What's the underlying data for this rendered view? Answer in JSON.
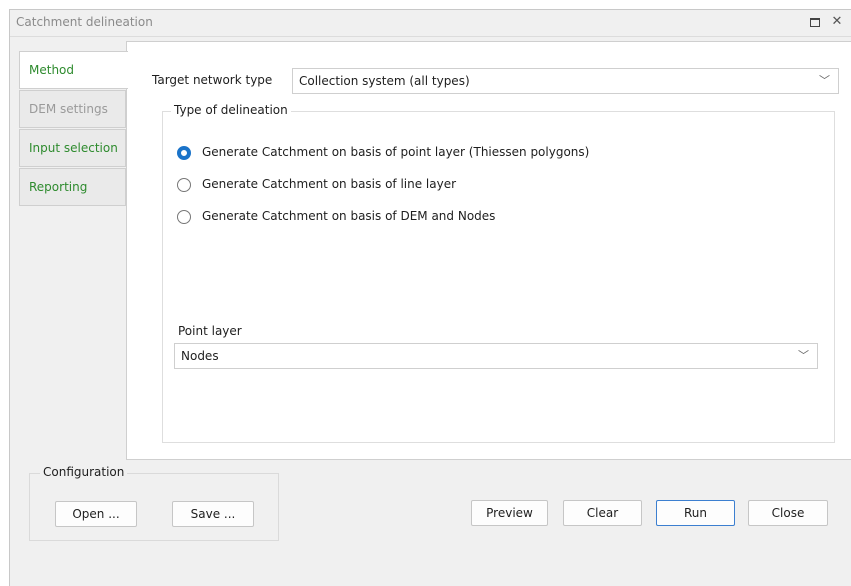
{
  "window": {
    "title": "Catchment delineation"
  },
  "tabs": [
    {
      "label": "Method",
      "state": "active"
    },
    {
      "label": "DEM settings",
      "state": "disabled"
    },
    {
      "label": "Input selection",
      "state": "enabled"
    },
    {
      "label": "Reporting",
      "state": "enabled"
    }
  ],
  "method": {
    "target_network_label": "Target network type",
    "target_network_value": "Collection system (all types)",
    "delineation_group_title": "Type of delineation",
    "options": [
      {
        "label": "Generate Catchment on basis of point layer (Thiessen polygons)",
        "checked": true
      },
      {
        "label": "Generate Catchment on basis of line layer",
        "checked": false
      },
      {
        "label": "Generate Catchment on basis of DEM and Nodes",
        "checked": false
      }
    ],
    "point_layer_label": "Point layer",
    "point_layer_value": "Nodes"
  },
  "configuration": {
    "title": "Configuration",
    "open_label": "Open ...",
    "save_label": "Save ..."
  },
  "actions": {
    "preview_label": "Preview",
    "clear_label": "Clear",
    "run_label": "Run",
    "close_label": "Close"
  },
  "colors": {
    "tab_text_active": "#2e8b2e",
    "tab_text_disabled": "#9a9a9a",
    "radio_selected": "#1a73c9",
    "primary_border": "#3c7fd0"
  },
  "icons": {
    "restore": "restore-icon",
    "close": "close-icon",
    "dropdown": "chevron-down-icon"
  }
}
